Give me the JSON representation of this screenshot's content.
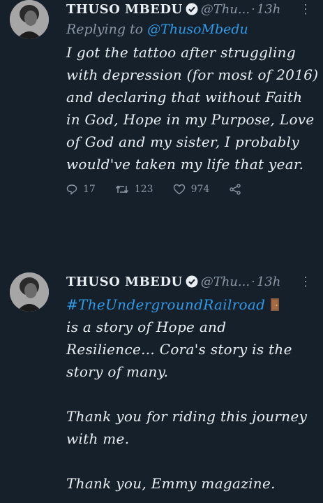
{
  "tweets": [
    {
      "name": "THUSO MBEDU",
      "handle": "@Thu...",
      "separator": "·",
      "time": "13h",
      "replying_prefix": "Replying to ",
      "replying_handle": "@ThusoMbedu",
      "text": "I got the tattoo after struggling with depression (for most of 2016) and declaring that without Faith in God, Hope in my Purpose, Love of God and my sister, I probably would've taken my life that year.",
      "stats": {
        "replies": "17",
        "retweets": "123",
        "likes": "974"
      }
    },
    {
      "name": "THUSO MBEDU",
      "handle": "@Thu...",
      "separator": "·",
      "time": "13h",
      "hashtag": "#TheUndergroundRailroad",
      "text1": "is a story of Hope and Resilience... Cora's story is the story of many.",
      "text2": "Thank you for riding this journey with me.",
      "text3": "Thank you, Emmy magazine."
    }
  ],
  "icons": {
    "verified": "verified-badge-icon",
    "more": "more-vertical-icon",
    "reply": "reply-icon",
    "retweet": "retweet-icon",
    "like": "heart-icon",
    "share": "share-icon",
    "door": "door-emoji-icon"
  },
  "colors": {
    "background": "#16202b",
    "accent": "#2f9be8",
    "muted": "#8a97a4"
  }
}
